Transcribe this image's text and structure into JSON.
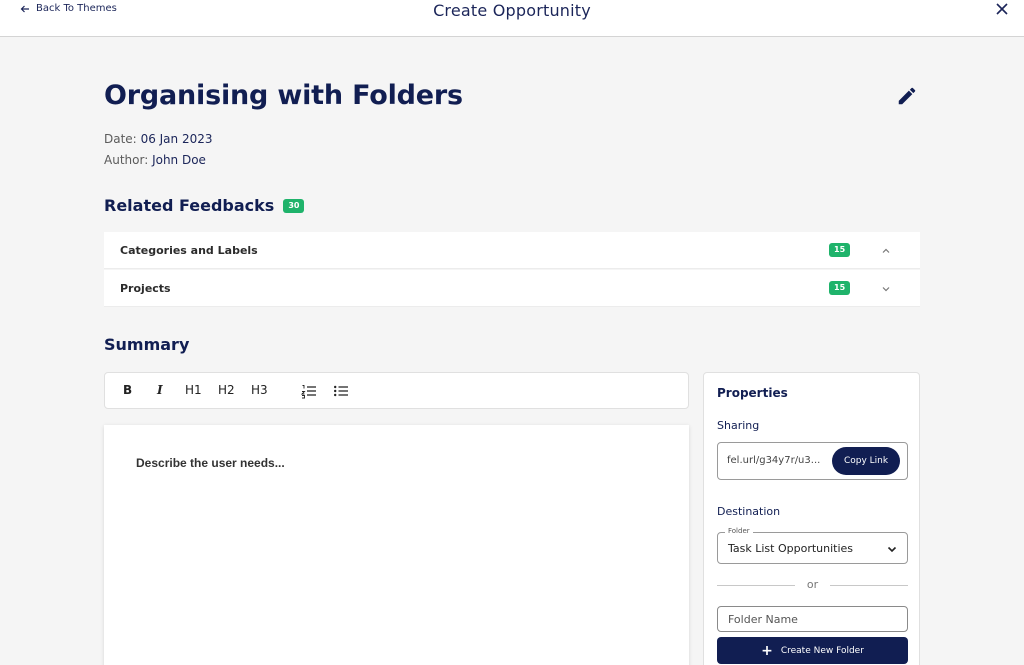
{
  "header": {
    "back_label": "Back To Themes",
    "title": "Create Opportunity"
  },
  "opportunity": {
    "title": "Organising with Folders",
    "date_label": "Date:",
    "date_value": "06 Jan 2023",
    "author_label": "Author:",
    "author_value": "John Doe"
  },
  "feedbacks": {
    "title": "Related Feedbacks",
    "count": "30",
    "items": [
      {
        "label": "Categories and Labels",
        "count": "15",
        "expanded": true
      },
      {
        "label": "Projects",
        "count": "15",
        "expanded": false
      }
    ]
  },
  "summary": {
    "title": "Summary",
    "toolbar": {
      "bold": "B",
      "italic": "I",
      "h1": "H1",
      "h2": "H2",
      "h3": "H3"
    },
    "placeholder": "Describe the user needs..."
  },
  "properties": {
    "title": "Properties",
    "sharing_label": "Sharing",
    "share_url": "fel.url/g34y7r/u3...",
    "copy_label": "Copy Link",
    "destination_label": "Destination",
    "folder_legend": "Folder",
    "folder_value": "Task List Opportunities",
    "or_label": "or",
    "folder_name_placeholder": "Folder Name",
    "create_label": "Create New Folder"
  },
  "colors": {
    "navy": "#111e52",
    "badge_green": "#1fb36b",
    "background": "#f5f5f5"
  }
}
